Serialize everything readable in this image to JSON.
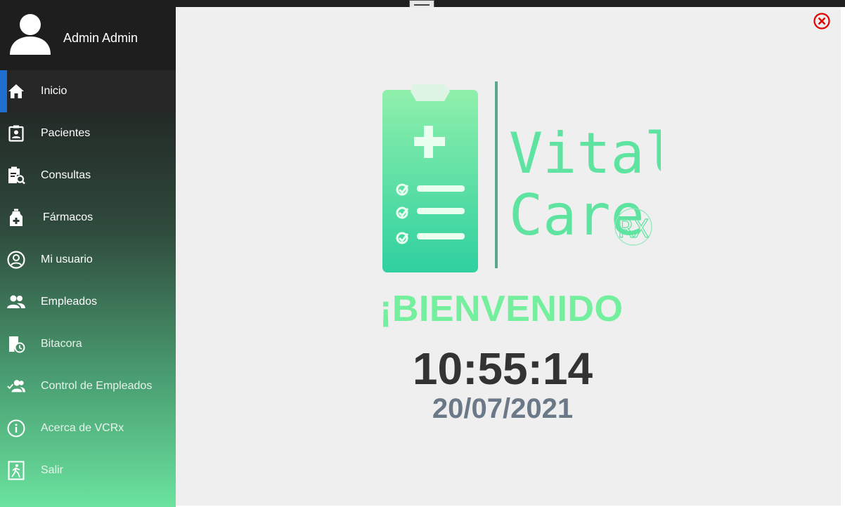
{
  "user": {
    "name": "Admin Admin"
  },
  "sidebar": {
    "items": [
      {
        "label": "Inicio",
        "icon": "home-icon",
        "active": true
      },
      {
        "label": "Pacientes",
        "icon": "patient-badge-icon"
      },
      {
        "label": "Consultas",
        "icon": "clipboard-search-icon"
      },
      {
        "label": "Fármacos",
        "icon": "medicine-bottle-icon"
      },
      {
        "label": "Mi usuario",
        "icon": "user-circle-icon"
      },
      {
        "label": "Empleados",
        "icon": "people-icon"
      },
      {
        "label": "Bitacora",
        "icon": "log-clock-icon"
      },
      {
        "label": "Control de Empleados",
        "icon": "people-control-icon"
      },
      {
        "label": "Acerca de VCRx",
        "icon": "info-icon"
      },
      {
        "label": "Salir",
        "icon": "exit-icon"
      }
    ]
  },
  "main": {
    "logo_line1": "Vital",
    "logo_line2": "Care",
    "logo_badge": "RX",
    "welcome": "¡BIENVENIDO",
    "time": "10:55:14",
    "date": "20/07/2021"
  },
  "colors": {
    "accent_green": "#74ef9e",
    "active_indicator": "#1e6fd0",
    "close_red": "#e00000"
  }
}
